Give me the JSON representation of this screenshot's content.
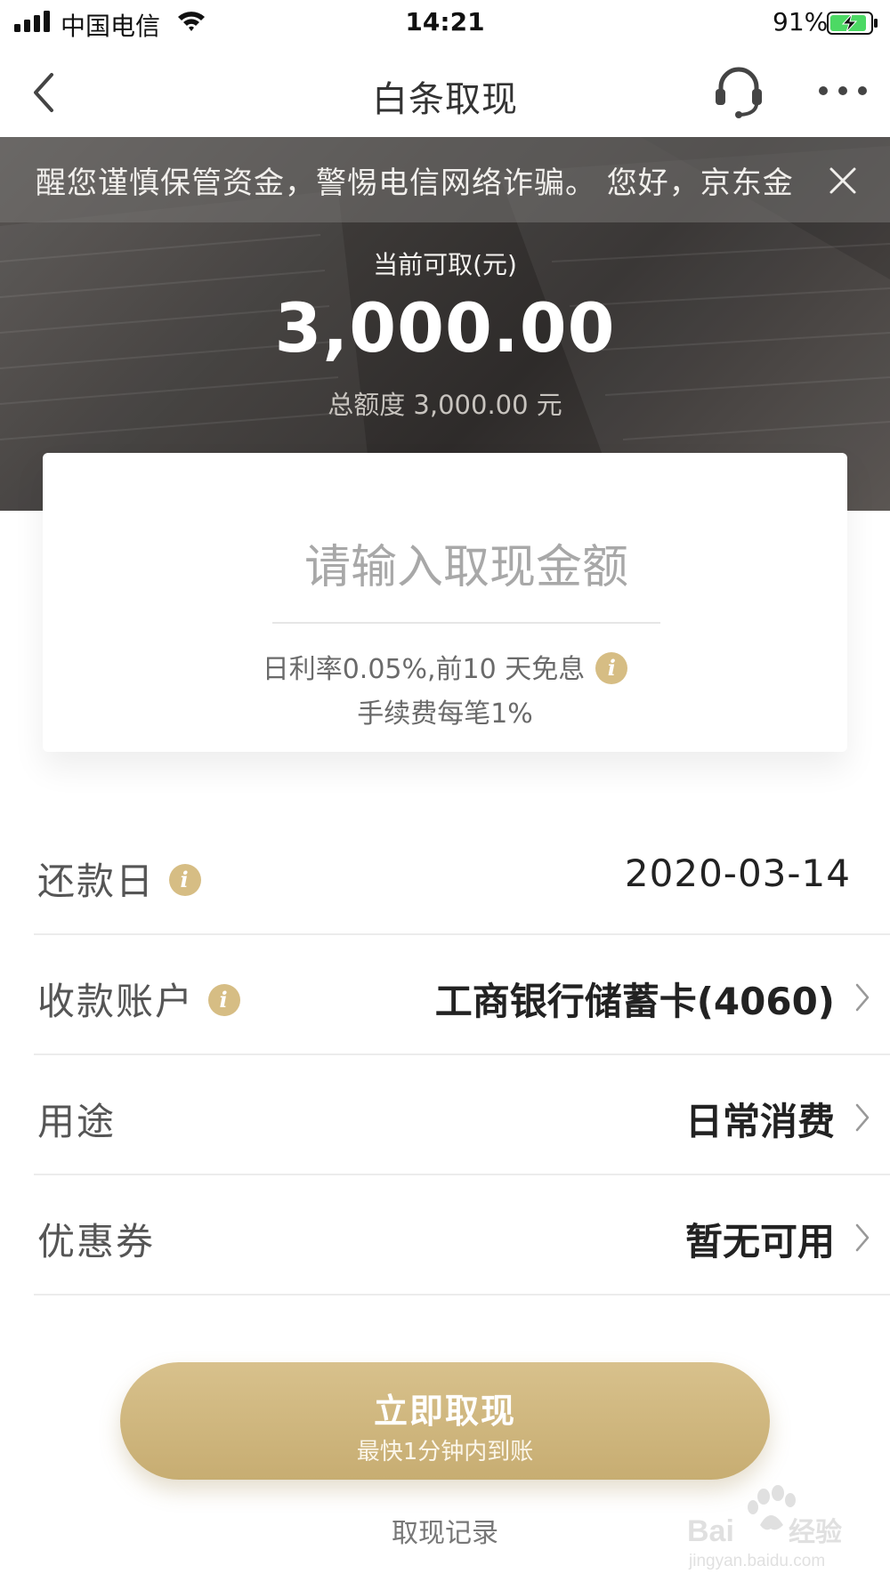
{
  "status_bar": {
    "carrier": "中国电信",
    "time": "14:21",
    "battery_percent": "91%",
    "battery_level": 0.91,
    "icons": [
      "signal-icon",
      "wifi-icon",
      "battery-charging-icon"
    ]
  },
  "nav": {
    "title": "白条取现",
    "icons": [
      "back-icon",
      "customer-service-icon",
      "more-icon"
    ]
  },
  "notice": {
    "text": "醒您谨慎保管资金，警惕电信网络诈骗。 您好，京东金",
    "icon": "close-icon"
  },
  "balance": {
    "label": "当前可取(元)",
    "amount": "3,000.00",
    "total_line": "总额度 3,000.00 元"
  },
  "withdraw_card": {
    "placeholder": "请输入取现金额",
    "rate_text": "日利率0.05%,前10 天免息",
    "fee_text": "手续费每笔1%"
  },
  "details": {
    "repay_day": {
      "label": "还款日",
      "value": "2020-03-14"
    },
    "account": {
      "label": "收款账户",
      "value": "工商银行储蓄卡(4060)"
    },
    "purpose": {
      "label": "用途",
      "value": "日常消费"
    },
    "coupon": {
      "label": "优惠券",
      "value": "暂无可用"
    }
  },
  "cta": {
    "label": "立即取现",
    "subtitle": "最快1分钟内到账"
  },
  "records_link": "取现记录",
  "watermark": {
    "text": "Baidu经验",
    "url_text": "jingyan.baidu.com"
  },
  "colors": {
    "accent_gold": "#c7ad72",
    "info_icon": "#d6bd84",
    "hero_dark": "#3c3937"
  }
}
